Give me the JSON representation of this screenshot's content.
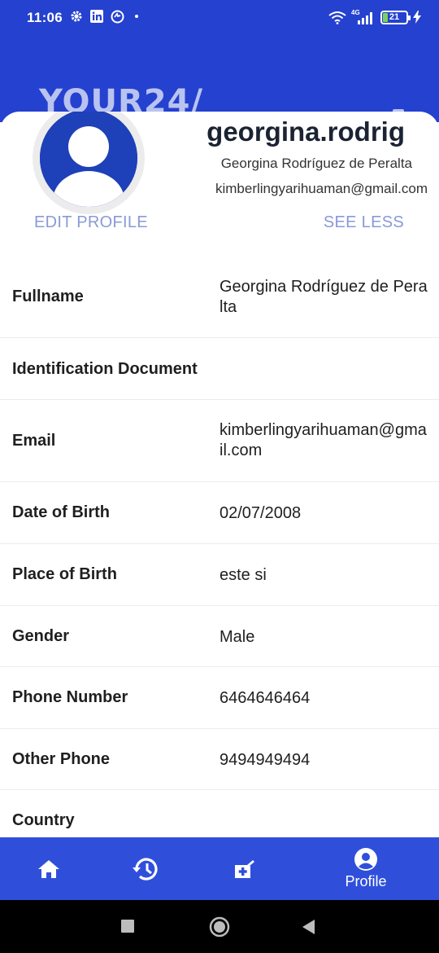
{
  "status_bar": {
    "time": "11:06",
    "network": "4G",
    "battery_level": "21",
    "icons": [
      "settings-icon",
      "linkedin-icon",
      "sync-icon",
      "dot-icon",
      "wifi-icon",
      "signal-icon",
      "battery-icon",
      "charging-icon"
    ]
  },
  "header": {
    "brand_text": "YOUR24/",
    "background_color": "#2541cf"
  },
  "profile": {
    "username": "georgina.rodrig",
    "fullname": "Georgina Rodríguez de Peralta",
    "email": "kimberlingyarihuaman@gmail.com",
    "edit_label": "EDIT PROFILE",
    "see_less_label": "SEE LESS"
  },
  "details": [
    {
      "label": "Fullname",
      "value": "Georgina Rodríguez de Peralta"
    },
    {
      "label": "Identification Document",
      "value": ""
    },
    {
      "label": "Email",
      "value": "kimberlingyarihuaman@gmail.com"
    },
    {
      "label": "Date of Birth",
      "value": "02/07/2008"
    },
    {
      "label": "Place of Birth",
      "value": "este si"
    },
    {
      "label": "Gender",
      "value": "Male"
    },
    {
      "label": "Phone Number",
      "value": "6464646464"
    },
    {
      "label": "Other Phone",
      "value": "9494949494"
    },
    {
      "label": "Country",
      "value": ""
    }
  ],
  "bottom_nav": {
    "items": [
      {
        "icon": "home-icon",
        "label": ""
      },
      {
        "icon": "history-icon",
        "label": ""
      },
      {
        "icon": "medical-add-icon",
        "label": ""
      },
      {
        "icon": "profile-icon",
        "label": "Profile"
      }
    ],
    "active": "Profile",
    "background_color": "#2f4fdb"
  },
  "system_nav": {
    "icons": [
      "recents-icon",
      "home-circle-icon",
      "back-icon"
    ]
  }
}
